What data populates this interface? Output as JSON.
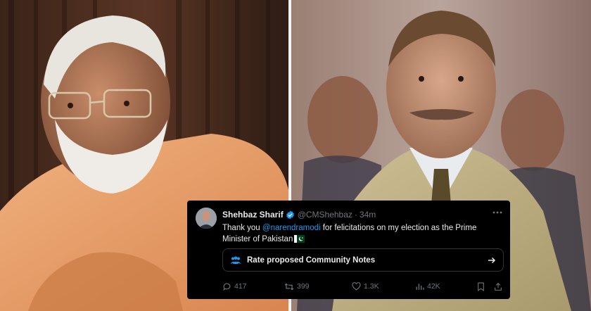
{
  "tweet": {
    "display_name": "Shehbaz Sharif",
    "handle": "@CMShehbaz",
    "separator": "·",
    "time": "34m",
    "text_before": "Thank you ",
    "mention": "@narendramodi",
    "text_after": " for felicitations on my election as the Prime Minister of Pakistan",
    "community_notes_label": "Rate proposed Community Notes",
    "replies": "417",
    "retweets": "399",
    "likes": "1.3K",
    "views": "42K",
    "colors": {
      "background": "#000000",
      "text": "#e7e9ea",
      "muted": "#71767b",
      "link": "#1d9bf0",
      "verified": "#1d9bf0"
    }
  },
  "icons": [
    "verified-badge-icon",
    "more-options-icon",
    "pakistan-flag-icon",
    "community-notes-icon",
    "arrow-right-icon",
    "reply-icon",
    "retweet-icon",
    "like-icon",
    "views-icon",
    "bookmark-icon",
    "share-icon"
  ]
}
